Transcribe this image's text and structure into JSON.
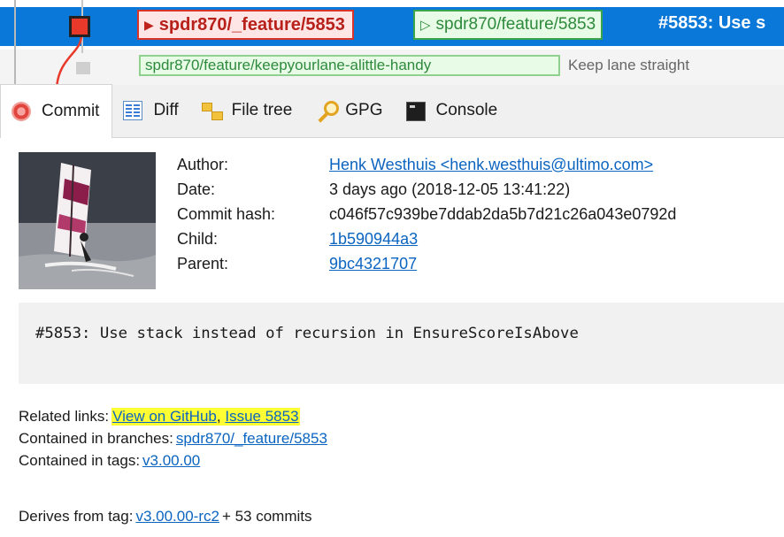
{
  "revision_graph": {
    "local_branch": "spdr870/_feature/5853",
    "remote_branch": "spdr870/feature/5853",
    "commit_subject": "#5853: Use s",
    "second_row_branch": "spdr870/feature/keepyourlane-alittle-handy",
    "second_row_subject": "Keep lane straight"
  },
  "tabs": [
    {
      "label": "Commit",
      "icon": "commit-icon"
    },
    {
      "label": "Diff",
      "icon": "diff-icon"
    },
    {
      "label": "File tree",
      "icon": "file-tree-icon"
    },
    {
      "label": "GPG",
      "icon": "gpg-key-icon"
    },
    {
      "label": "Console",
      "icon": "console-icon"
    }
  ],
  "commit": {
    "author_label": "Author:",
    "author_value": "Henk Westhuis <henk.westhuis@ultimo.com>",
    "date_label": "Date:",
    "date_value": "3 days ago (2018-12-05 13:41:22)",
    "hash_label": "Commit hash:",
    "hash_value": "c046f57c939be7ddab2da5b7d21c26a043e0792d",
    "child_label": "Child:",
    "child_value": "1b590944a3",
    "parent_label": "Parent:",
    "parent_value": "9bc4321707",
    "message": "#5853: Use stack instead of recursion in EnsureScoreIsAbove"
  },
  "details": {
    "related_links_label": "Related links:",
    "related_link_github": "View on GitHub",
    "related_link_separator": ",",
    "related_link_issue": "Issue 5853",
    "branches_label": "Contained in branches:",
    "branches_value": "spdr870/_feature/5853",
    "tags_label": "Contained in tags:",
    "tags_value": "v3.00.00",
    "derives_label": "Derives from tag:",
    "derives_tag": "v3.00.00-rc2",
    "derives_suffix": "+ 53 commits"
  },
  "colors": {
    "selected_row": "#0a78d8",
    "commit_node": "#e8392b",
    "local_branch_border": "#d9342a",
    "remote_branch_border": "#3aa54a",
    "link": "#0b64c0",
    "highlight": "#ffff33"
  }
}
